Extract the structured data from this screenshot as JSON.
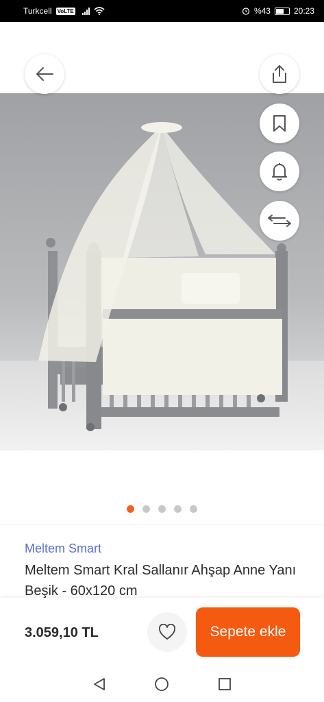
{
  "status_bar": {
    "carrier": "Turkcell",
    "volte": "VoLTE",
    "battery": "%43",
    "time": "20:23"
  },
  "image_gallery": {
    "dot_count": 5,
    "active_index": 0
  },
  "product": {
    "brand": "Meltem Smart",
    "title": "Meltem Smart Kral Sallanır Ahşap Anne Yanı Beşik - 60x120 cm",
    "price": "3.059,10 TL"
  },
  "actions": {
    "add_to_cart_label": "Sepete ekle"
  },
  "colors": {
    "accent": "#f45a10",
    "brand_link": "#5b6fcf",
    "active_dot": "#f06422"
  }
}
